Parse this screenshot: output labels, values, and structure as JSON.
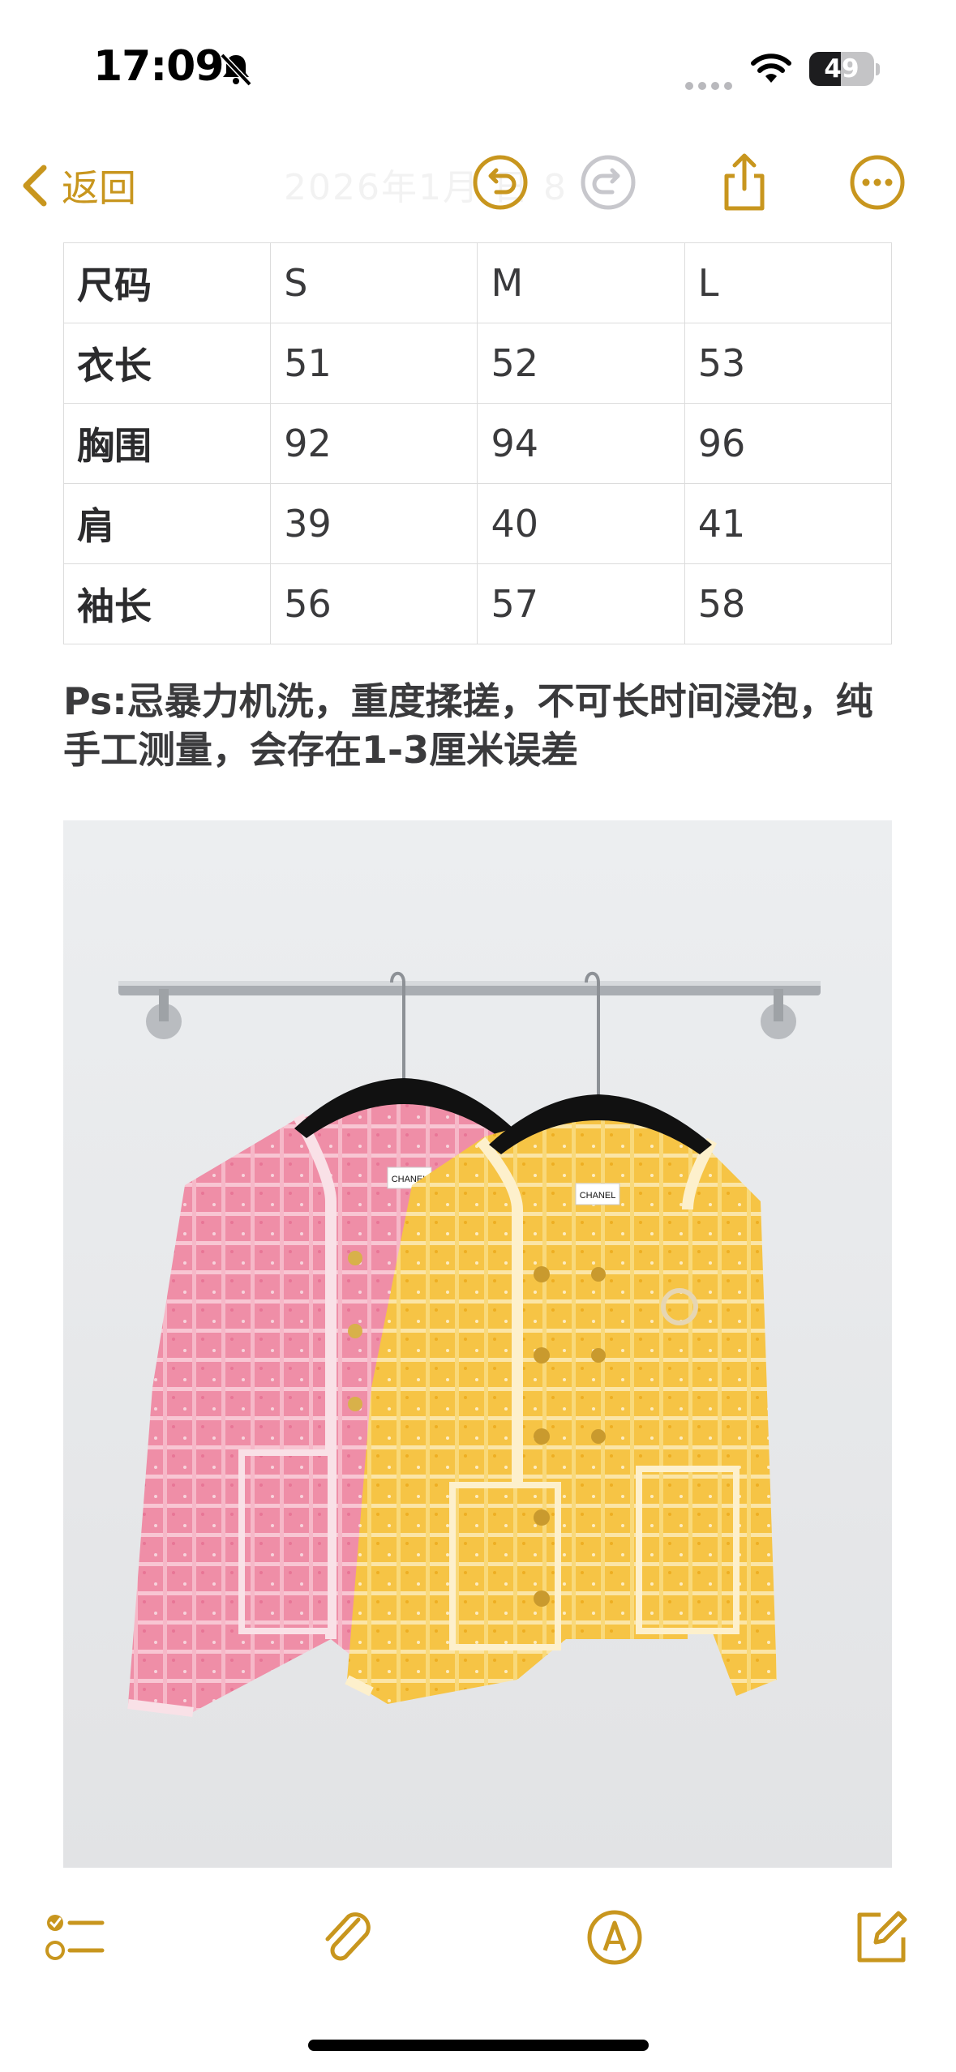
{
  "status_bar": {
    "time": "17:09",
    "battery_level": "49",
    "battery_percent": 49,
    "icons": [
      "bell-slash-icon",
      "cellular-dots-icon",
      "wifi-icon",
      "battery-icon"
    ]
  },
  "nav": {
    "back_label": "返回",
    "title_faded": "2026年1月 日 8",
    "buttons": [
      "undo-icon",
      "redo-icon",
      "share-icon",
      "more-icon"
    ]
  },
  "size_table": {
    "header": [
      "尺码",
      "S",
      "M",
      "L"
    ],
    "rows": [
      [
        "衣长",
        "51",
        "52",
        "53"
      ],
      [
        "胸围",
        "92",
        "94",
        "96"
      ],
      [
        "肩",
        "39",
        "40",
        "41"
      ],
      [
        "袖长",
        "56",
        "57",
        "58"
      ]
    ]
  },
  "note": "Ps:忌暴力机洗，重度揉搓，不可长时间浸泡，纯手工测量，会存在1-3厘米误差",
  "photo": {
    "label_left": "CHANEL",
    "label_right": "CHANEL"
  },
  "toolbar": {
    "buttons": [
      "checklist-icon",
      "paperclip-icon",
      "markup-pen-icon",
      "compose-icon"
    ]
  },
  "colors": {
    "accent": "#c8961e",
    "pink": "#ee8fa6",
    "yellow": "#f4c24a"
  }
}
